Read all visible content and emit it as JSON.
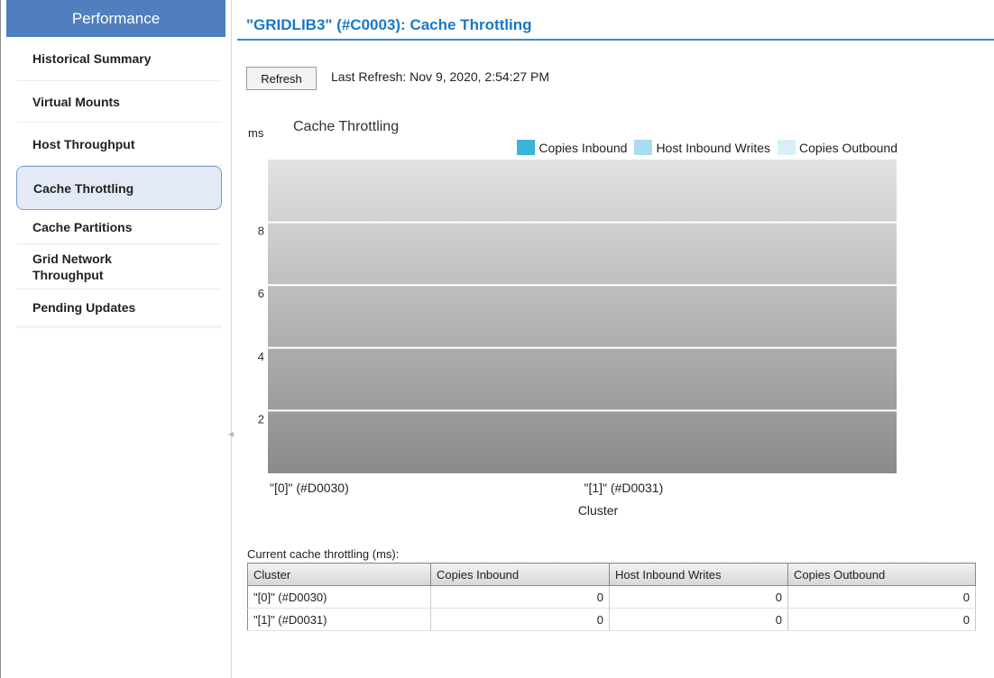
{
  "sidebar": {
    "header": "Performance",
    "items": [
      {
        "label": "Historical Summary"
      },
      {
        "label": "Virtual Mounts"
      },
      {
        "label": "Host Throughput"
      },
      {
        "label": "Cache Throttling",
        "active": true
      },
      {
        "label": "Cache Partitions"
      },
      {
        "label": "Grid Network Throughput"
      },
      {
        "label": "Pending Updates"
      }
    ]
  },
  "main": {
    "title": "\"GRIDLIB3\" (#C0003): Cache Throttling",
    "refresh_label": "Refresh",
    "last_refresh": "Last Refresh:  Nov 9, 2020, 2:54:27 PM"
  },
  "chart_data": {
    "type": "bar",
    "title": "Cache Throttling",
    "ylabel": "ms",
    "xlabel": "Cluster",
    "categories": [
      "\"[0]\" (#D0030)",
      "\"[1]\" (#D0031)"
    ],
    "series": [
      {
        "name": "Copies Inbound",
        "values": [
          0,
          0
        ],
        "color": "#3ab4d8"
      },
      {
        "name": "Host Inbound Writes",
        "values": [
          0,
          0
        ],
        "color": "#a8dcef"
      },
      {
        "name": "Copies Outbound",
        "values": [
          0,
          0
        ],
        "color": "#d6f0f8"
      }
    ],
    "yticks": [
      "2",
      "4",
      "6",
      "8"
    ],
    "ylim": [
      0,
      10
    ],
    "grid": true,
    "legend": "top-right"
  },
  "table": {
    "caption": "Current cache throttling (ms):",
    "columns": [
      "Cluster",
      "Copies Inbound",
      "Host Inbound Writes",
      "Copies Outbound"
    ],
    "rows": [
      [
        "\"[0]\" (#D0030)",
        "0",
        "0",
        "0"
      ],
      [
        "\"[1]\" (#D0031)",
        "0",
        "0",
        "0"
      ]
    ]
  },
  "colors": {
    "accent": "#1a78c8",
    "sidebar_header": "#4f7fbf"
  }
}
